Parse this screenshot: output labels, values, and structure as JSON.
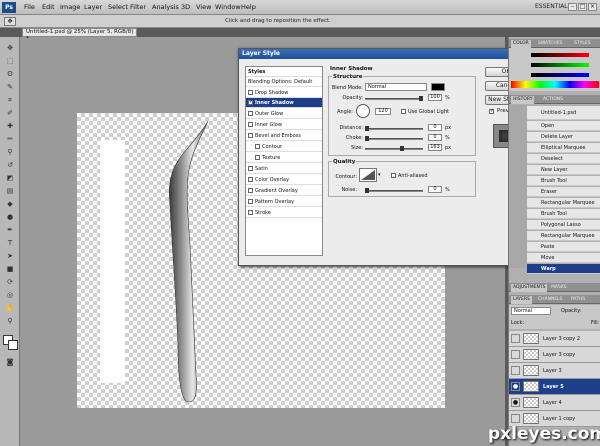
{
  "app": {
    "logo": "Ps",
    "workspace": "ESSENTIALS"
  },
  "menu": [
    "File",
    "Edit",
    "Image",
    "Layer",
    "Select",
    "Filter",
    "Analysis",
    "3D",
    "View",
    "Window",
    "Help"
  ],
  "options": {
    "hint": "Click and drag to reposition the effect."
  },
  "document": {
    "tab_title": "Untitled-1.psd @ 25% (Layer 5, RGB/8) *"
  },
  "dialog": {
    "title": "Layer Style",
    "styles_header": "Styles",
    "blending_options": "Blending Options: Default",
    "styles": [
      {
        "label": "Drop Shadow",
        "checked": false
      },
      {
        "label": "Inner Shadow",
        "checked": true,
        "selected": true
      },
      {
        "label": "Outer Glow",
        "checked": false
      },
      {
        "label": "Inner Glow",
        "checked": false
      },
      {
        "label": "Bevel and Emboss",
        "checked": false
      },
      {
        "label": "Contour",
        "checked": false
      },
      {
        "label": "Texture",
        "checked": false
      },
      {
        "label": "Satin",
        "checked": false
      },
      {
        "label": "Color Overlay",
        "checked": false
      },
      {
        "label": "Gradient Overlay",
        "checked": false
      },
      {
        "label": "Pattern Overlay",
        "checked": false
      },
      {
        "label": "Stroke",
        "checked": false
      }
    ],
    "section_title": "Inner Shadow",
    "structure": {
      "title": "Structure",
      "blend_mode_label": "Blend Mode:",
      "blend_mode": "Normal",
      "opacity_label": "Opacity:",
      "opacity": "100",
      "angle_label": "Angle:",
      "angle": "120",
      "global_light": "Use Global Light",
      "distance_label": "Distance:",
      "distance": "0",
      "choke_label": "Choke:",
      "choke": "0",
      "size_label": "Size:",
      "size": "163",
      "unit_pct": "%",
      "unit_px": "px",
      "opacity_frac": 1.0,
      "distance_frac": 0.0,
      "choke_frac": 0.0,
      "size_frac": 0.65
    },
    "quality": {
      "title": "Quality",
      "contour_label": "Contour:",
      "anti_aliased": "Anti-aliased",
      "noise_label": "Noise:",
      "noise": "0",
      "noise_frac": 0.0
    },
    "buttons": {
      "ok": "OK",
      "cancel": "Cancel",
      "new_style": "New Style...",
      "preview": "Preview"
    }
  },
  "panels": {
    "color_tabs": [
      "COLOR",
      "SWATCHES",
      "STYLES"
    ],
    "history_tabs": [
      "HISTORY",
      "ACTIONS"
    ],
    "history_doc": "Untitled-1.psd",
    "history": [
      "Open",
      "Delete Layer",
      "Elliptical Marquee",
      "Deselect",
      "New Layer",
      "Brush Tool",
      "Eraser",
      "Rectangular Marquee",
      "Brush Tool",
      "Polygonal Lasso",
      "Rectangular Marquee",
      "Paste",
      "Move",
      "Warp"
    ],
    "adj_tabs": [
      "ADJUSTMENTS",
      "MASKS"
    ],
    "layer_tabs": [
      "LAYERS",
      "CHANNELS",
      "PATHS"
    ],
    "blend": "Normal",
    "opacity_label": "Opacity:",
    "lock_label": "Lock:",
    "fill_label": "Fill:",
    "layers": [
      {
        "name": "Layer 3 copy 2",
        "visible": false
      },
      {
        "name": "Layer 3 copy",
        "visible": false
      },
      {
        "name": "Layer 3",
        "visible": false
      },
      {
        "name": "Layer 5",
        "visible": true,
        "current": true
      },
      {
        "name": "Layer 4",
        "visible": true
      },
      {
        "name": "Layer 1 copy",
        "visible": false
      }
    ]
  },
  "watermark": "pxleyes.com"
}
